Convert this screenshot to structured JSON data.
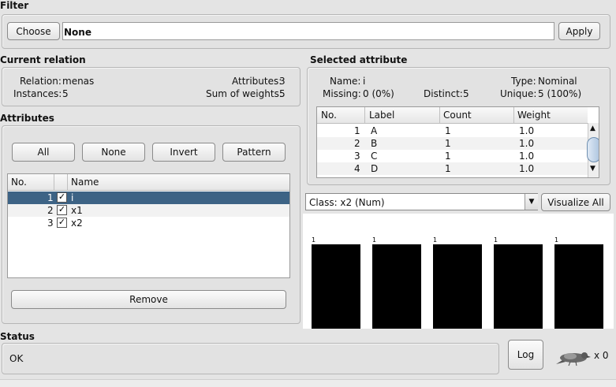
{
  "filter": {
    "title": "Filter",
    "choose_label": "Choose",
    "value": "None",
    "apply_label": "Apply"
  },
  "current_relation": {
    "title": "Current relation",
    "relation_label": "Relation:",
    "relation_value": "menas",
    "instances_label": "Instances:",
    "instances_value": "5",
    "attributes_label": "Attributes:",
    "attributes_value": "3",
    "sum_weights_label": "Sum of weights:",
    "sum_weights_value": "5"
  },
  "attributes": {
    "title": "Attributes",
    "buttons": [
      "All",
      "None",
      "Invert",
      "Pattern"
    ],
    "columns": [
      "No.",
      "Name"
    ],
    "rows": [
      {
        "no": "1",
        "name": "i",
        "checked": true,
        "selected": true
      },
      {
        "no": "2",
        "name": "x1",
        "checked": true,
        "selected": false
      },
      {
        "no": "3",
        "name": "x2",
        "checked": true,
        "selected": false
      }
    ],
    "remove_label": "Remove"
  },
  "selected_attribute": {
    "title": "Selected attribute",
    "name_label": "Name:",
    "name_value": "i",
    "type_label": "Type:",
    "type_value": "Nominal",
    "missing_label": "Missing:",
    "missing_value": "0 (0%)",
    "distinct_label": "Distinct:",
    "distinct_value": "5",
    "unique_label": "Unique:",
    "unique_value": "5 (100%)",
    "columns": [
      "No.",
      "Label",
      "Count",
      "Weight"
    ],
    "rows": [
      {
        "no": "1",
        "label": "A",
        "count": "1",
        "weight": "1.0"
      },
      {
        "no": "2",
        "label": "B",
        "count": "1",
        "weight": "1.0"
      },
      {
        "no": "3",
        "label": "C",
        "count": "1",
        "weight": "1.0"
      },
      {
        "no": "4",
        "label": "D",
        "count": "1",
        "weight": "1.0"
      }
    ]
  },
  "class_select": {
    "value": "Class: x2 (Num)",
    "visualize_all_label": "Visualize All"
  },
  "histogram": {
    "bar_labels": [
      "1",
      "1",
      "1",
      "1",
      "1"
    ],
    "bar_values": [
      1,
      1,
      1,
      1,
      1
    ]
  },
  "status": {
    "title": "Status",
    "text": "OK",
    "log_label": "Log",
    "count_text": "x 0"
  },
  "colors": {
    "selection": "#3d6385",
    "bar": "#000000",
    "background": "#e4e4e4"
  }
}
